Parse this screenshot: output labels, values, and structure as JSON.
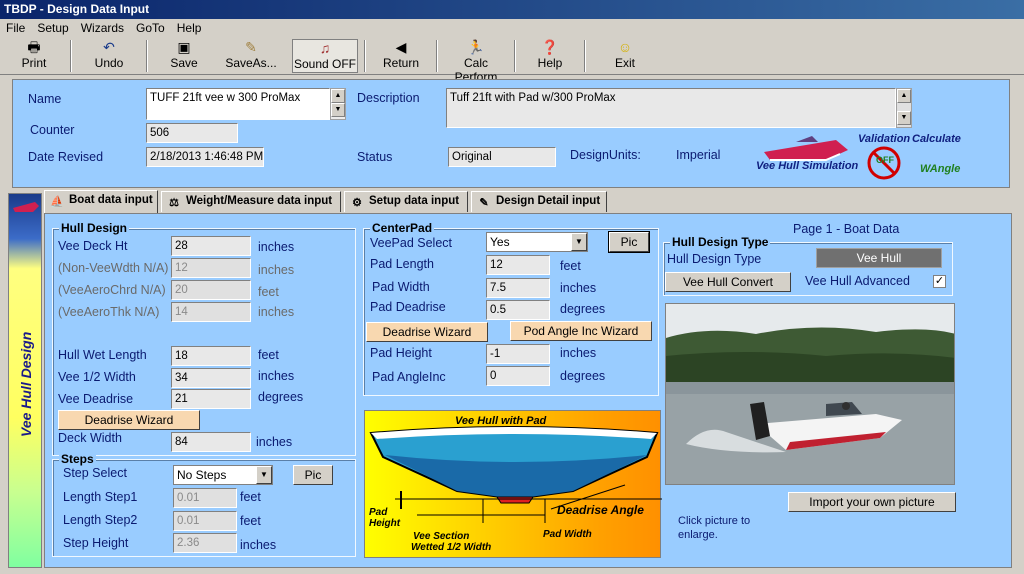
{
  "window": {
    "title": "TBDP - Design Data Input"
  },
  "menu": [
    "File",
    "Setup",
    "Wizards",
    "GoTo",
    "Help"
  ],
  "toolbar": {
    "print": "Print",
    "undo": "Undo",
    "save": "Save",
    "saveas": "SaveAs...",
    "sound": "Sound OFF",
    "return": "Return",
    "calc": "Calc Perform",
    "help": "Help",
    "exit": "Exit"
  },
  "header": {
    "name_label": "Name",
    "name_value": "TUFF 21ft vee w 300 ProMax",
    "counter_label": "Counter",
    "counter_value": "506",
    "date_label": "Date Revised",
    "date_value": "2/18/2013 1:46:48 PM",
    "description_label": "Description",
    "description_value": "Tuff 21ft with Pad w/300 ProMax",
    "status_label": "Status",
    "status_value": "Original",
    "units_label": "DesignUnits:",
    "units_value": "Imperial",
    "logo_sim": "Vee Hull Simulation",
    "logo_val": "Validation",
    "logo_calc": "Calculate",
    "logo_wangle": "WAngle",
    "logo_off": "OFF"
  },
  "sidebar": {
    "title": "Vee Hull Design"
  },
  "tabs": [
    "Boat data input",
    "Weight/Measure data input",
    "Setup data input",
    "Design Detail input"
  ],
  "hull": {
    "title": "Hull Design",
    "deck_ht_label": "Vee Deck Ht",
    "deck_ht": "28",
    "deck_ht_unit": "inches",
    "nonvee_label": "(Non-VeeWdth N/A)",
    "nonvee": "12",
    "nonvee_unit": "inches",
    "aerochrd_label": "(VeeAeroChrd N/A)",
    "aerochrd": "20",
    "aerochrd_unit": "feet",
    "aerothk_label": "(VeeAeroThk N/A)",
    "aerothk": "14",
    "aerothk_unit": "inches",
    "wetlen_label": "Hull Wet Length",
    "wetlen": "18",
    "wetlen_unit": "feet",
    "halfw_label": "Vee 1/2 Width",
    "halfw": "34",
    "halfw_unit": "inches",
    "deadrise_label": "Vee Deadrise",
    "deadrise": "21",
    "deadrise_unit": "degrees",
    "deadrise_wizard": "Deadrise Wizard",
    "deckw_label": "Deck Width",
    "deckw": "84",
    "deckw_unit": "inches"
  },
  "steps": {
    "title": "Steps",
    "select_label": "Step Select",
    "select_value": "No Steps",
    "pic": "Pic",
    "len1_label": "Length Step1",
    "len1": "0.01",
    "len1_unit": "feet",
    "len2_label": "Length Step2",
    "len2": "0.01",
    "len2_unit": "feet",
    "height_label": "Step Height",
    "height": "2.36",
    "height_unit": "inches"
  },
  "centerpad": {
    "title": "CenterPad",
    "select_label": "VeePad Select",
    "select_value": "Yes",
    "pic": "Pic",
    "length_label": "Pad Length",
    "length": "12",
    "length_unit": "feet",
    "width_label": "Pad Width",
    "width": "7.5",
    "width_unit": "inches",
    "deadrise_label": "Pad Deadrise",
    "deadrise": "0.5",
    "deadrise_unit": "degrees",
    "deadrise_wizard": "Deadrise Wizard",
    "angle_wizard": "Pod Angle Inc Wizard",
    "height_label": "Pad Height",
    "height": "-1",
    "height_unit": "inches",
    "angleinc_label": "Pad AngleInc",
    "angleinc": "0",
    "angleinc_unit": "degrees"
  },
  "diagram": {
    "title": "Vee Hull with Pad",
    "pad_height": "Pad Height",
    "vee_section": "Vee Section",
    "wetted": "Wetted 1/2 Width",
    "pad_width": "Pad Width",
    "deadrise_angle": "Deadrise Angle"
  },
  "right": {
    "page_label": "Page 1 - Boat Data",
    "hdt_title": "Hull Design Type",
    "hdt_label": "Hull Design Type",
    "hdt_value": "Vee Hull",
    "convert": "Vee Hull Convert",
    "advanced_label": "Vee Hull Advanced",
    "advanced_checked": "✓",
    "import": "Import your own picture",
    "click_hint1": "Click picture to",
    "click_hint2": "enlarge."
  }
}
